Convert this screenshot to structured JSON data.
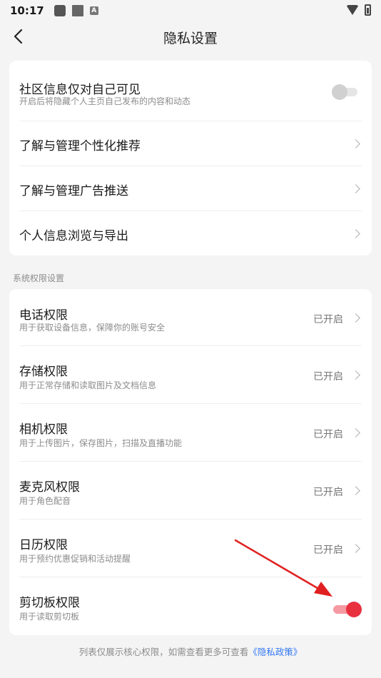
{
  "status_bar": {
    "time": "10:17",
    "notif_icon_letter": "A"
  },
  "header": {
    "title": "隐私设置"
  },
  "card1": {
    "items": [
      {
        "label": "社区信息仅对自己可见",
        "sub": "开启后将隐藏个人主页自己发布的内容和动态",
        "toggle": "off"
      },
      {
        "label": "了解与管理个性化推荐"
      },
      {
        "label": "了解与管理广告推送"
      },
      {
        "label": "个人信息浏览与导出"
      }
    ]
  },
  "section2_label": "系统权限设置",
  "card2": {
    "items": [
      {
        "label": "电话权限",
        "sub": "用于获取设备信息，保障你的账号安全",
        "status": "已开启"
      },
      {
        "label": "存储权限",
        "sub": "用于正常存储和读取图片及文档信息",
        "status": "已开启"
      },
      {
        "label": "相机权限",
        "sub": "用于上传图片，保存图片，扫描及直播功能",
        "status": "已开启"
      },
      {
        "label": "麦克风权限",
        "sub": "用于角色配音",
        "status": "已开启"
      },
      {
        "label": "日历权限",
        "sub": "用于预约优惠促销和活动提醒",
        "status": "已开启"
      },
      {
        "label": "剪切板权限",
        "sub": "用于读取剪切板",
        "toggle": "on"
      }
    ]
  },
  "footer": {
    "text": "列表仅展示核心权限，如需查看更多可查看",
    "link": "《隐私政策》"
  },
  "colors": {
    "accent": "#e8303f",
    "link": "#3478f6",
    "annotation_arrow": "#e02020"
  }
}
